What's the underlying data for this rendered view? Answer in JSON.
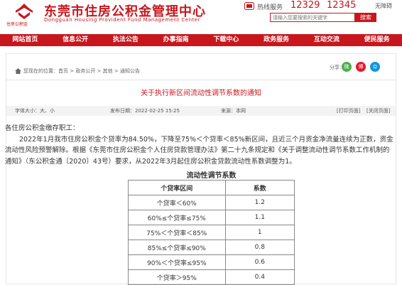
{
  "header": {
    "logo_text": "住房公积金",
    "site_name": "东莞市住房公积金管理中心",
    "site_name_en": "Dongguan Housing Provident Fund Management Center",
    "hotline_label": "热线服务",
    "hotline_1": "12329",
    "hotline_2": "12345",
    "accessibility": "无障碍",
    "search_placeholder": "请输入您要搜索的关键字",
    "search_button": "搜索"
  },
  "nav": [
    "网站首页",
    "信息公开",
    "执法公告",
    "办事指南",
    "下载中心",
    "政务服务",
    "互动交流",
    "便民服务"
  ],
  "breadcrumb": "您现在的位置：首页 > 政务公开 > 其他 > 通知公告",
  "share": {
    "label": "分享：",
    "wechat": "微",
    "weibo": "博",
    "qq": "Q"
  },
  "article": {
    "title": "关于执行新区间流动性调节系数的通知",
    "font_size_label": "字体大小：大、小",
    "publish_date": "发布日期：2022-02-25 15:25",
    "source": "来源：本网",
    "print_label": "[打印页面]",
    "close_label": "[关闭页面]",
    "greeting": "各住房公积金缴存职工：",
    "paragraph": "2022年1月我市住房公积金个贷率为84.50%，下降至75%＜个贷率＜85%新区间，且近三个月资金净流量连续为正数，资金流动性风险预警解除。根据《东莞市住房公积金个人住房贷款管理办法》第二十九条规定和《关于调整流动性调节系数工作机制的通知》（东公积金通〔2020〕43号）要求，从2022年3月起住房公积金贷款流动性系数调整为1。"
  },
  "table": {
    "caption": "流动性调节系数",
    "headers": [
      "个贷率区间",
      "系数"
    ],
    "rows": [
      [
        "个贷率＜60%",
        "1.2"
      ],
      [
        "60%≤个贷率≤75%",
        "1.1"
      ],
      [
        "75%＜个贷率＜85%",
        "1"
      ],
      [
        "85%≤个贷率≤90%",
        "0.8"
      ],
      [
        "90%＜个贷率≤95%",
        "0.6"
      ],
      [
        "个贷率＞95%",
        "0.4"
      ]
    ]
  },
  "colors": {
    "brand": "#c8161d"
  }
}
